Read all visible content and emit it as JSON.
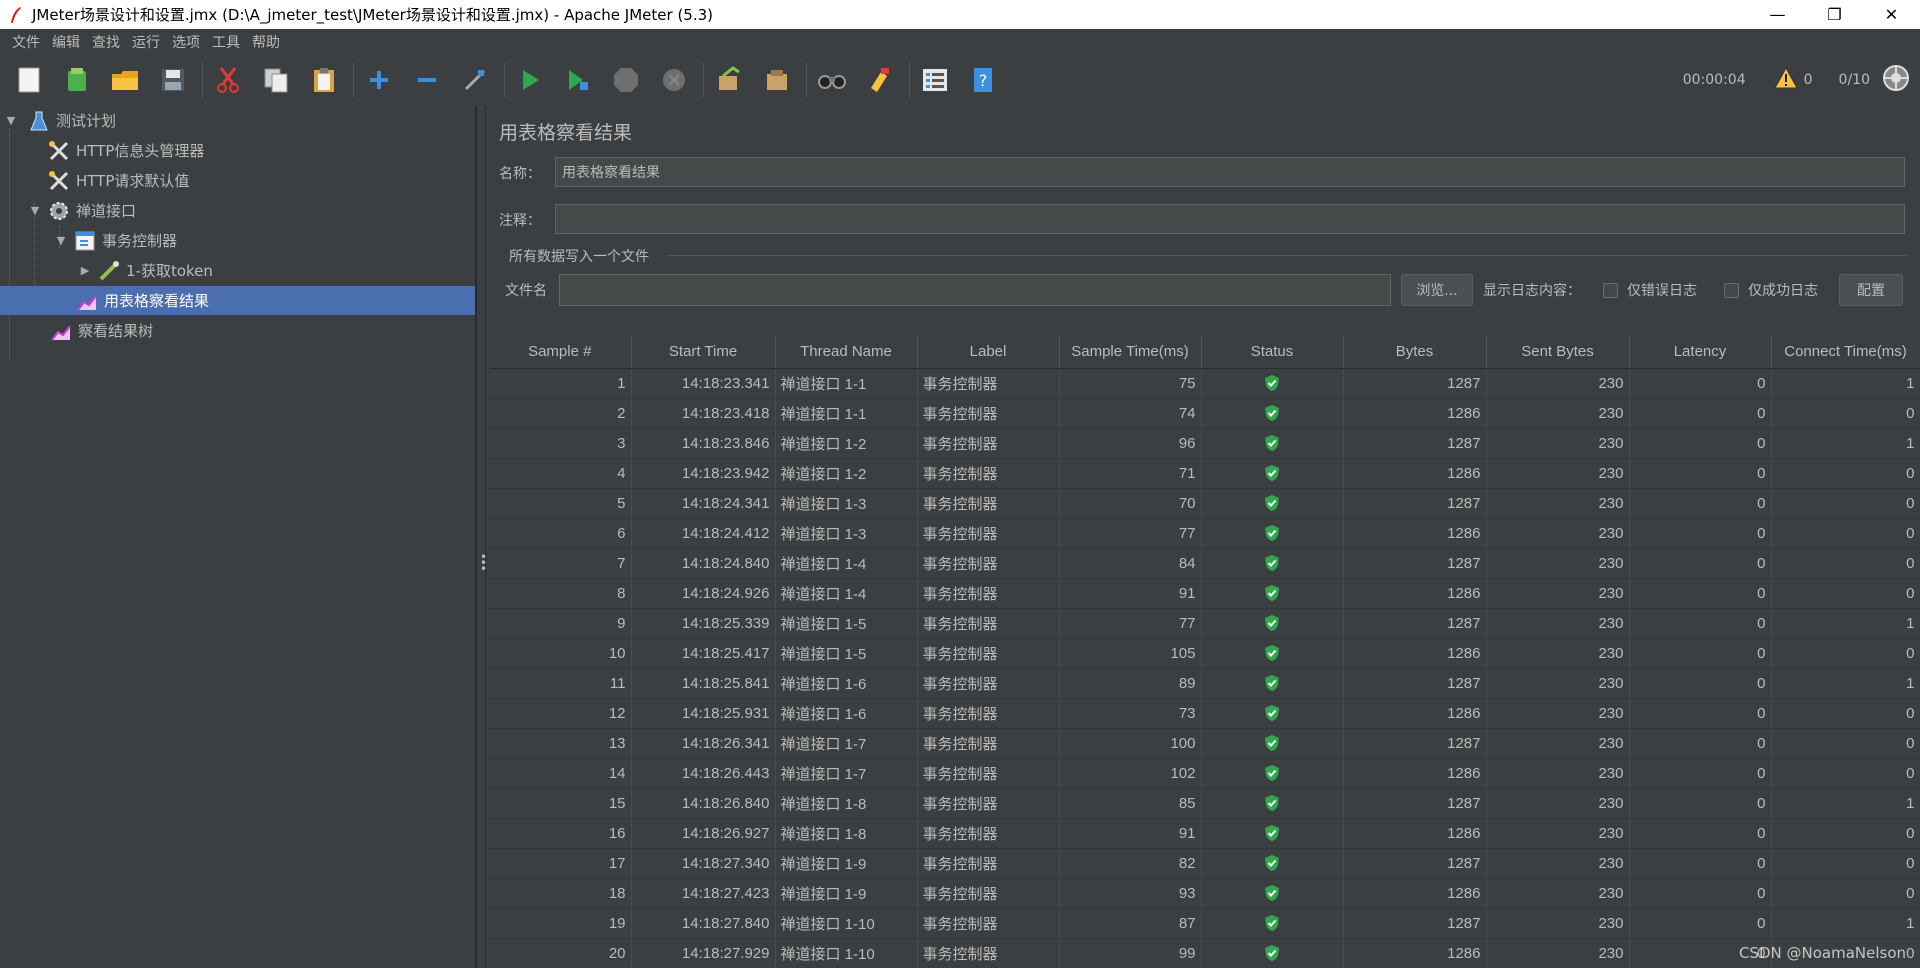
{
  "window": {
    "title": "JMeter场景设计和设置.jmx (D:\\A_jmeter_test\\JMeter场景设计和设置.jmx) - Apache JMeter (5.3)",
    "minimize": "—",
    "restore": "❐",
    "close": "✕"
  },
  "menu": [
    "文件",
    "编辑",
    "查找",
    "运行",
    "选项",
    "工具",
    "帮助"
  ],
  "toolbar": {
    "buttons": [
      "new-icon",
      "templates-icon",
      "open-icon",
      "save-icon",
      "cut-icon",
      "copy-icon",
      "paste-icon",
      "expand-icon",
      "collapse-icon",
      "toggle-icon",
      "start-icon",
      "start-no-pause-icon",
      "stop-icon",
      "shutdown-icon",
      "clear-icon",
      "clear-all-icon",
      "search-icon",
      "reset-search-icon",
      "function-helper-icon",
      "help-icon"
    ],
    "timer": "00:00:04",
    "warning_count": "0",
    "threads": "0/10"
  },
  "tree": {
    "items": [
      {
        "label": "测试计划",
        "icon": "flask-icon"
      },
      {
        "label": "HTTP信息头管理器",
        "icon": "tools-icon"
      },
      {
        "label": "HTTP请求默认值",
        "icon": "tools-icon"
      },
      {
        "label": "禅道接口",
        "icon": "gear-icon"
      },
      {
        "label": "事务控制器",
        "icon": "controller-icon"
      },
      {
        "label": "1-获取token",
        "icon": "sampler-icon"
      },
      {
        "label": "用表格察看结果",
        "icon": "chart-icon"
      },
      {
        "label": "察看结果树",
        "icon": "chart-icon"
      }
    ]
  },
  "panel": {
    "title": "用表格察看结果",
    "name_label": "名称：",
    "name_value": "用表格察看结果",
    "comment_label": "注释：",
    "comment_value": "",
    "file_group_title": "所有数据写入一个文件",
    "file_label": "文件名",
    "file_value": "",
    "browse_label": "浏览...",
    "log_label": "显示日志内容：",
    "errors_only_label": "仅错误日志",
    "success_only_label": "仅成功日志",
    "configure_label": "配置"
  },
  "table": {
    "columns": [
      "Sample #",
      "Start Time",
      "Thread Name",
      "Label",
      "Sample Time(ms)",
      "Status",
      "Bytes",
      "Sent Bytes",
      "Latency",
      "Connect Time(ms)"
    ],
    "rows": [
      [
        "1",
        "14:18:23.341",
        "禅道接口 1-1",
        "事务控制器",
        "75",
        "ok",
        "1287",
        "230",
        "0",
        "1"
      ],
      [
        "2",
        "14:18:23.418",
        "禅道接口 1-1",
        "事务控制器",
        "74",
        "ok",
        "1286",
        "230",
        "0",
        "0"
      ],
      [
        "3",
        "14:18:23.846",
        "禅道接口 1-2",
        "事务控制器",
        "96",
        "ok",
        "1287",
        "230",
        "0",
        "1"
      ],
      [
        "4",
        "14:18:23.942",
        "禅道接口 1-2",
        "事务控制器",
        "71",
        "ok",
        "1286",
        "230",
        "0",
        "0"
      ],
      [
        "5",
        "14:18:24.341",
        "禅道接口 1-3",
        "事务控制器",
        "70",
        "ok",
        "1287",
        "230",
        "0",
        "0"
      ],
      [
        "6",
        "14:18:24.412",
        "禅道接口 1-3",
        "事务控制器",
        "77",
        "ok",
        "1286",
        "230",
        "0",
        "0"
      ],
      [
        "7",
        "14:18:24.840",
        "禅道接口 1-4",
        "事务控制器",
        "84",
        "ok",
        "1287",
        "230",
        "0",
        "0"
      ],
      [
        "8",
        "14:18:24.926",
        "禅道接口 1-4",
        "事务控制器",
        "91",
        "ok",
        "1286",
        "230",
        "0",
        "0"
      ],
      [
        "9",
        "14:18:25.339",
        "禅道接口 1-5",
        "事务控制器",
        "77",
        "ok",
        "1287",
        "230",
        "0",
        "1"
      ],
      [
        "10",
        "14:18:25.417",
        "禅道接口 1-5",
        "事务控制器",
        "105",
        "ok",
        "1286",
        "230",
        "0",
        "0"
      ],
      [
        "11",
        "14:18:25.841",
        "禅道接口 1-6",
        "事务控制器",
        "89",
        "ok",
        "1287",
        "230",
        "0",
        "1"
      ],
      [
        "12",
        "14:18:25.931",
        "禅道接口 1-6",
        "事务控制器",
        "73",
        "ok",
        "1286",
        "230",
        "0",
        "0"
      ],
      [
        "13",
        "14:18:26.341",
        "禅道接口 1-7",
        "事务控制器",
        "100",
        "ok",
        "1287",
        "230",
        "0",
        "0"
      ],
      [
        "14",
        "14:18:26.443",
        "禅道接口 1-7",
        "事务控制器",
        "102",
        "ok",
        "1286",
        "230",
        "0",
        "0"
      ],
      [
        "15",
        "14:18:26.840",
        "禅道接口 1-8",
        "事务控制器",
        "85",
        "ok",
        "1287",
        "230",
        "0",
        "1"
      ],
      [
        "16",
        "14:18:26.927",
        "禅道接口 1-8",
        "事务控制器",
        "91",
        "ok",
        "1286",
        "230",
        "0",
        "0"
      ],
      [
        "17",
        "14:18:27.340",
        "禅道接口 1-9",
        "事务控制器",
        "82",
        "ok",
        "1287",
        "230",
        "0",
        "0"
      ],
      [
        "18",
        "14:18:27.423",
        "禅道接口 1-9",
        "事务控制器",
        "93",
        "ok",
        "1286",
        "230",
        "0",
        "0"
      ],
      [
        "19",
        "14:18:27.840",
        "禅道接口 1-10",
        "事务控制器",
        "87",
        "ok",
        "1287",
        "230",
        "0",
        "1"
      ],
      [
        "20",
        "14:18:27.929",
        "禅道接口 1-10",
        "事务控制器",
        "99",
        "ok",
        "1286",
        "230",
        "0",
        "0"
      ]
    ]
  },
  "watermark": "CSDN @NoamaNelson",
  "colors": {
    "background": "#3c3f41",
    "selection": "#4b6eaf",
    "status_ok": "#2fa84f"
  }
}
